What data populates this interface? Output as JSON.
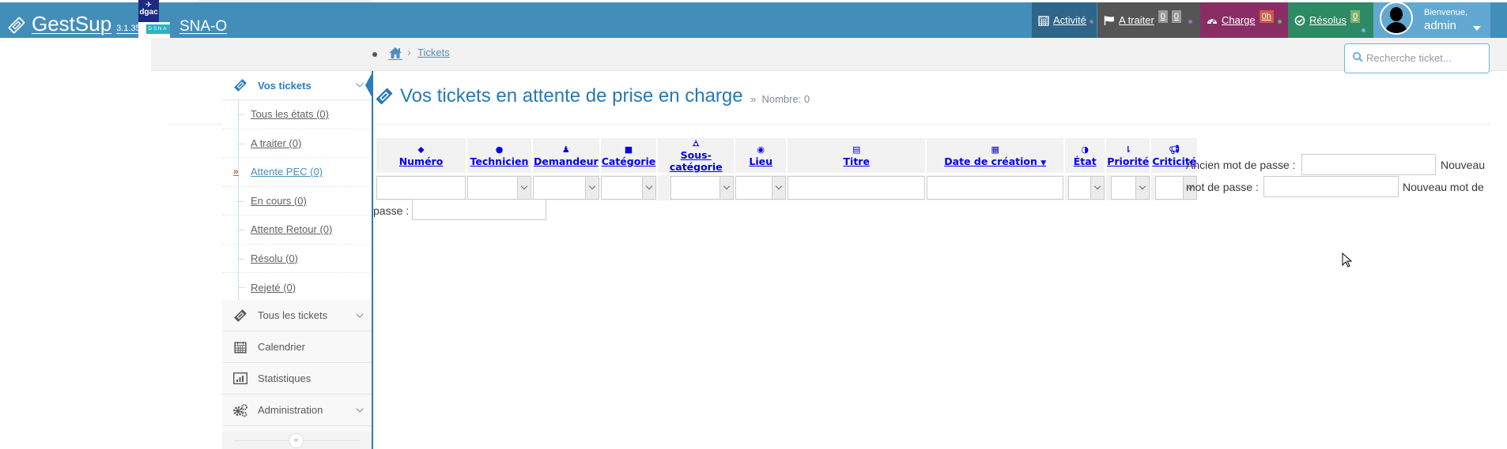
{
  "header": {
    "brand": "GestSup",
    "version": "3.1.35",
    "logo_dgac": "dgac",
    "logo_dsna": "DSNA",
    "site_name": "SNA-O",
    "nav": {
      "activite": {
        "label": "Activité",
        "color": "#2e6589"
      },
      "a_traiter": {
        "label": "A traiter",
        "badges": [
          "0",
          "0"
        ],
        "color": "#555555"
      },
      "charge": {
        "label": "Charge",
        "badge": "0h",
        "color": "#892e65",
        "badge_color": "#d15b47"
      },
      "resolus": {
        "label": "Résolus",
        "badge": "0",
        "color": "#2e8965",
        "badge_color": "#82af6f"
      }
    },
    "user": {
      "greeting": "Bienvenue,",
      "name": "admin"
    }
  },
  "breadcrumb": {
    "items": [
      "Tickets"
    ]
  },
  "search": {
    "placeholder": "Recherche ticket..."
  },
  "sidebar": {
    "vos_tickets": "Vos tickets",
    "submenu": [
      {
        "label": "Tous les états (0)",
        "active": false
      },
      {
        "label": "A traiter (0)",
        "active": false
      },
      {
        "label": "Attente PEC (0)",
        "active": true
      },
      {
        "label": "En cours (0)",
        "active": false
      },
      {
        "label": "Attente Retour (0)",
        "active": false
      },
      {
        "label": "Résolu (0)",
        "active": false
      },
      {
        "label": "Rejeté (0)",
        "active": false
      }
    ],
    "items": [
      {
        "label": "Tous les tickets",
        "has_children": true
      },
      {
        "label": "Calendrier",
        "has_children": false
      },
      {
        "label": "Statistiques",
        "has_children": false
      },
      {
        "label": "Administration",
        "has_children": true
      }
    ],
    "collapse_symbol": "«"
  },
  "page": {
    "title": "Vos tickets en attente de prise en charge",
    "subtitle_prefix": "»",
    "subtitle": "Nombre: 0"
  },
  "table": {
    "columns": [
      {
        "label": "Numéro",
        "icon": "tag-icon",
        "filter": "text"
      },
      {
        "label": "Technicien",
        "icon": "user-icon",
        "filter": "select"
      },
      {
        "label": "Demandeur",
        "icon": "male-icon",
        "filter": "select"
      },
      {
        "label": "Catégorie",
        "icon": "square-icon",
        "filter": "select"
      },
      {
        "label": "Sous-catégorie",
        "icon": "sitemap-icon",
        "filter": "select"
      },
      {
        "label": "Lieu",
        "icon": "globe-icon",
        "filter": "select"
      },
      {
        "label": "Titre",
        "icon": "file-icon",
        "filter": "text"
      },
      {
        "label": "Date de création",
        "icon": "calendar-icon",
        "filter": "text",
        "sorted": "desc"
      },
      {
        "label": "État",
        "icon": "adjust-icon",
        "filter": "select"
      },
      {
        "label": "Priorité",
        "icon": "sort-amount-icon",
        "filter": "select"
      },
      {
        "label": "Criticité",
        "icon": "bullhorn-icon",
        "filter": "select"
      }
    ]
  },
  "password_form": {
    "old_label": "Ancien mot de passe :",
    "new_label_a": "Nouveau",
    "new_label_b": "mot de passe :",
    "confirm_label_a": "Nouveau mot de",
    "confirm_label_b": "passe :"
  }
}
